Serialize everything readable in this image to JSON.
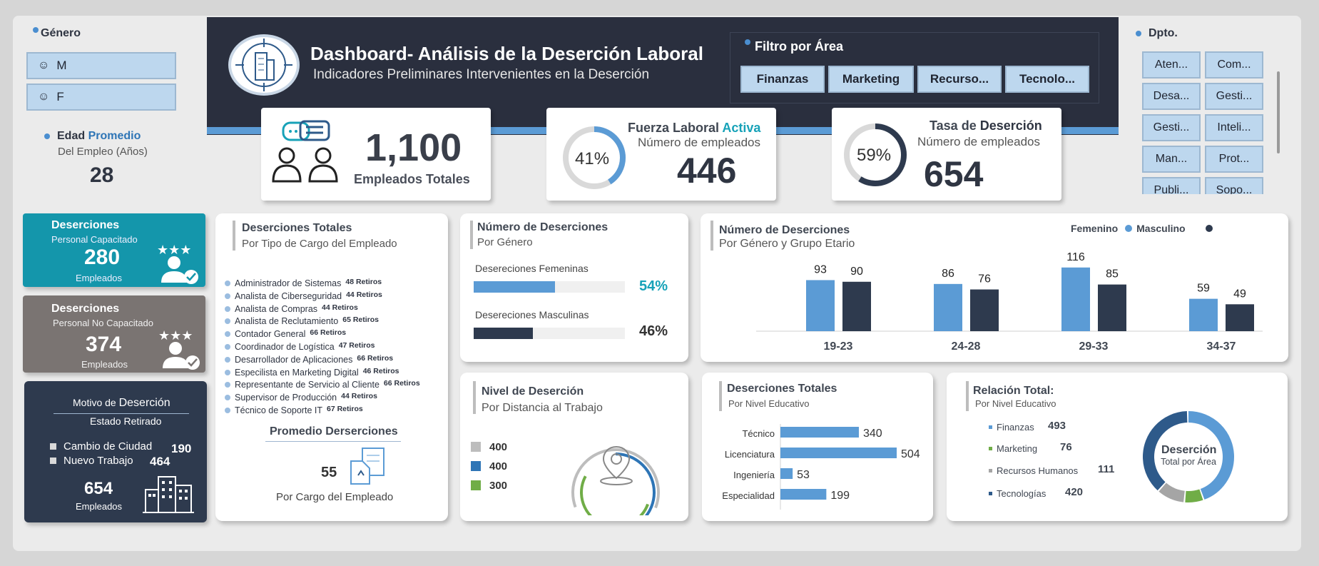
{
  "header": {
    "title": "Dashboard- Análisis de la Deserción Laboral",
    "subtitle": "Indicadores Preliminares Intervenientes en la Deserción"
  },
  "area_filter": {
    "title": "Filtro por Área",
    "options": [
      "Finanzas",
      "Marketing",
      "Recurso...",
      "Tecnolo..."
    ]
  },
  "gender": {
    "title": "Género",
    "options": [
      "M",
      "F"
    ]
  },
  "age": {
    "title_a": "Edad ",
    "title_b": "Promedio",
    "subtitle": "Del Empleo (Años)",
    "value": "28"
  },
  "dept": {
    "title": "Dpto.",
    "options": [
      "Aten...",
      "Com...",
      "Desa...",
      "Gesti...",
      "Gesti...",
      "Inteli...",
      "Man...",
      "Prot...",
      "Publi...",
      "Sopo..."
    ]
  },
  "kpi_total": {
    "value": "1,100",
    "label": "Empleados Totales"
  },
  "kpi_active": {
    "title_a": "Fuerza Laboral ",
    "title_b": "Activa",
    "subtitle": "Número de empleados",
    "value": "446",
    "pct": "41%",
    "fraction": 0.41
  },
  "kpi_rate": {
    "title_a": "Tasa de ",
    "title_b": "Deserción",
    "subtitle": "Número de empleados",
    "value": "654",
    "pct": "59%",
    "fraction": 0.59
  },
  "trained": {
    "title": "Deserciones",
    "subtitle": "Personal Capacitado",
    "value": "280",
    "unit": "Empleados"
  },
  "untrained": {
    "title": "Deserciones",
    "subtitle": "Personal No Capacitado",
    "value": "374",
    "unit": "Empleados"
  },
  "reason": {
    "title_a": "Motivo de ",
    "title_b": "Deserción",
    "subtitle": "Estado Retirado",
    "items": [
      {
        "label": "Cambio de Ciudad",
        "value": "190"
      },
      {
        "label": "Nuevo Trabajo",
        "value": "464"
      }
    ],
    "total": "654",
    "unit": "Empleados"
  },
  "by_role": {
    "title": "Deserciones Totales",
    "subtitle": "Por Tipo de Cargo del Empleado",
    "items": [
      {
        "label": "Administrador de Sistemas",
        "value": "48 Retiros"
      },
      {
        "label": "Analista de Ciberseguridad",
        "value": "44 Retiros"
      },
      {
        "label": "Analista de Compras",
        "value": "44 Retiros"
      },
      {
        "label": "Analista de Reclutamiento",
        "value": "65 Retiros"
      },
      {
        "label": "Contador General",
        "value": "66 Retiros"
      },
      {
        "label": "Coordinador de Logística",
        "value": "47 Retiros"
      },
      {
        "label": "Desarrollador de Aplicaciones",
        "value": "66 Retiros"
      },
      {
        "label": "Especilista en Marketing Digital",
        "value": "46 Retiros"
      },
      {
        "label": "Representante de Servicio al Cliente",
        "value": "66 Retiros"
      },
      {
        "label": "Supervisor de Producción",
        "value": "44 Retiros"
      },
      {
        "label": "Técnico de Soporte IT",
        "value": "67 Retiros"
      }
    ],
    "avg_title": "Promedio Derserciones",
    "avg_value": "55",
    "avg_label": "Por Cargo del Empleado"
  },
  "by_gender": {
    "title": "Número de Deserciones",
    "subtitle": "Por Género",
    "items": [
      {
        "label": "Desereciones Femeninas",
        "pct": "54%",
        "fraction": 0.54,
        "color": "#5b9bd5"
      },
      {
        "label": "Desereciones Masculinas",
        "pct": "46%",
        "fraction": 0.46,
        "color": "#2e3a4e"
      }
    ]
  },
  "distance": {
    "title": "Nivel de Deserción",
    "subtitle": "Por Distancia al Trabajo",
    "items": [
      {
        "value": "400",
        "color": "#bdbdbd"
      },
      {
        "value": "400",
        "color": "#2e75b6"
      },
      {
        "value": "300",
        "color": "#70ad47"
      }
    ]
  },
  "age_chart": {
    "title": "Número de Deserciones",
    "subtitle": "Por Género y Grupo Etario",
    "legend": [
      "Femenino",
      "Masculino"
    ],
    "colors": [
      "#5b9bd5",
      "#2e3a4e"
    ]
  },
  "edu_chart": {
    "title": "Deserciones Totales",
    "subtitle": "Por Nivel Educativo",
    "color": "#5b9bd5"
  },
  "area_rel": {
    "title": "Relación Total:",
    "subtitle": "Por Nivel Educativo",
    "center_title": "Deserción",
    "center_sub": "Total por Área",
    "items": [
      {
        "label": "Finanzas",
        "value": "493",
        "color": "#5b9bd5"
      },
      {
        "label": "Marketing",
        "value": "76",
        "color": "#70ad47"
      },
      {
        "label": "Recursos Humanos",
        "value": "111",
        "color": "#a5a5a5"
      },
      {
        "label": "Tecnologías",
        "value": "420",
        "color": "#2e5a8a"
      }
    ]
  },
  "chart_data": [
    {
      "type": "bar",
      "title": "Número de Deserciones",
      "subtitle": "Por Género y Grupo Etario",
      "categories": [
        "19-23",
        "24-28",
        "29-33",
        "34-37"
      ],
      "series": [
        {
          "name": "Femenino",
          "values": [
            93,
            86,
            116,
            59
          ]
        },
        {
          "name": "Masculino",
          "values": [
            90,
            76,
            85,
            49
          ]
        }
      ],
      "legend": "top-right"
    },
    {
      "type": "bar",
      "orientation": "horizontal",
      "title": "Deserciones Totales",
      "subtitle": "Por Nivel Educativo",
      "categories": [
        "Técnico",
        "Licenciatura",
        "Ingeniería",
        "Especialidad"
      ],
      "values": [
        340,
        504,
        53,
        199
      ]
    },
    {
      "type": "pie",
      "title": "Relación Total:",
      "categories": [
        "Finanzas",
        "Marketing",
        "Recursos Humanos",
        "Tecnologías"
      ],
      "values": [
        493,
        76,
        111,
        420
      ]
    },
    {
      "type": "pie",
      "title": "Nivel de Deserción",
      "subtitle": "Por Distancia al Trabajo",
      "values": [
        400,
        400,
        300
      ]
    }
  ]
}
